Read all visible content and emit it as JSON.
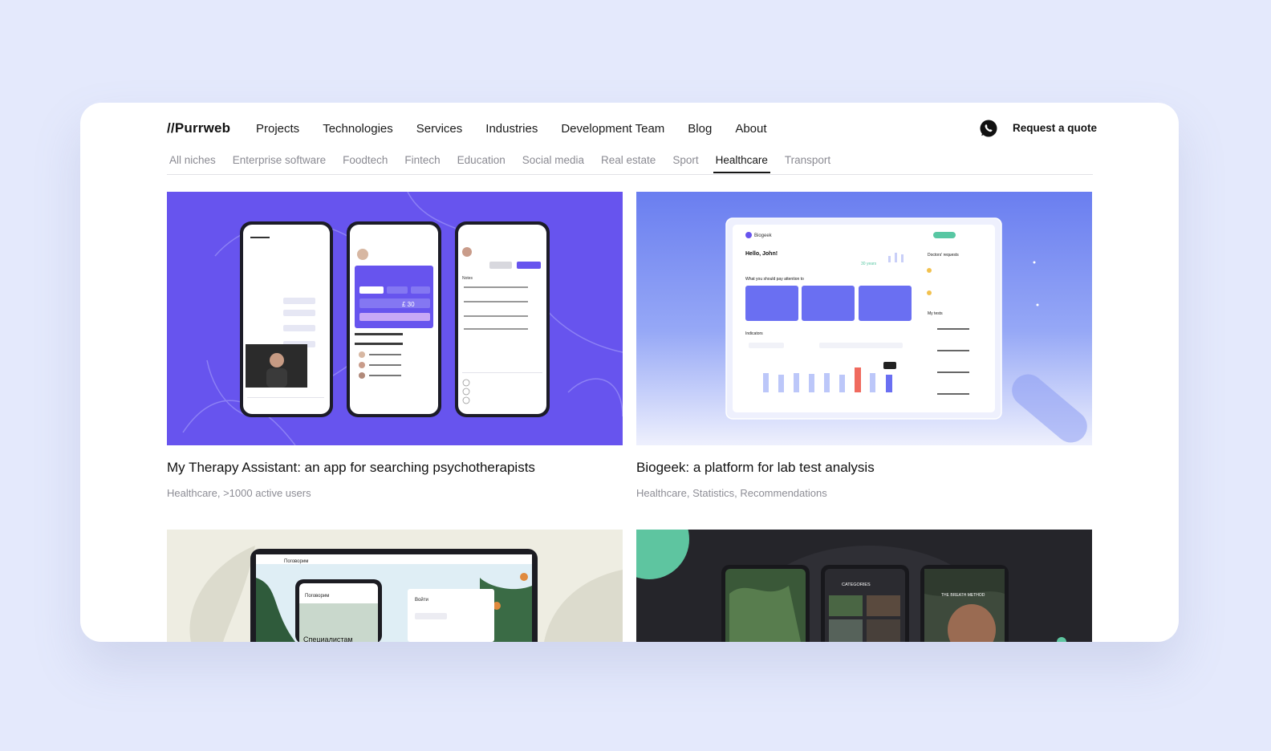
{
  "nav": {
    "logo": "//Purrweb",
    "items": [
      "Projects",
      "Technologies",
      "Services",
      "Industries",
      "Development Team",
      "Blog",
      "About"
    ],
    "cta": "Request a quote"
  },
  "niches": {
    "items": [
      "All niches",
      "Enterprise software",
      "Foodtech",
      "Fintech",
      "Education",
      "Social media",
      "Real estate",
      "Sport",
      "Healthcare",
      "Transport"
    ],
    "active": "Healthcare"
  },
  "projects": [
    {
      "title": "My Therapy Assistant: an app for searching psychotherapists",
      "tags": "Healthcare, >1000 active users"
    },
    {
      "title": "Biogeek: a platform for lab test analysis",
      "tags": "Healthcare, Statistics, Recommendations"
    },
    {
      "title": "",
      "tags": ""
    },
    {
      "title": "",
      "tags": ""
    }
  ],
  "mockups": {
    "biogeek_greeting": "Hello, John!",
    "biogeek_logo": "Biogeek",
    "biogeek_attention": "What you should pay attention to",
    "biogeek_indicators": "Indicators",
    "biogeek_requests": "Doctors' requests",
    "biogeek_tests": "My tests",
    "biogeek_age": "30 years",
    "therapy_price": "£ 30",
    "therapy_notes": "Notes",
    "pogovorim_brand": "Поговорим",
    "pogovorim_specialists": "Специалистам",
    "pogovorim_login": "Войти",
    "breath_categories": "CATEGORIES",
    "breath_title": "THE BREATH METHOD"
  },
  "colors": {
    "accent_purple": "#6754ee",
    "bg": "#e4e9fc",
    "card_dark": "#25252a",
    "teal": "#5ec5a0"
  }
}
